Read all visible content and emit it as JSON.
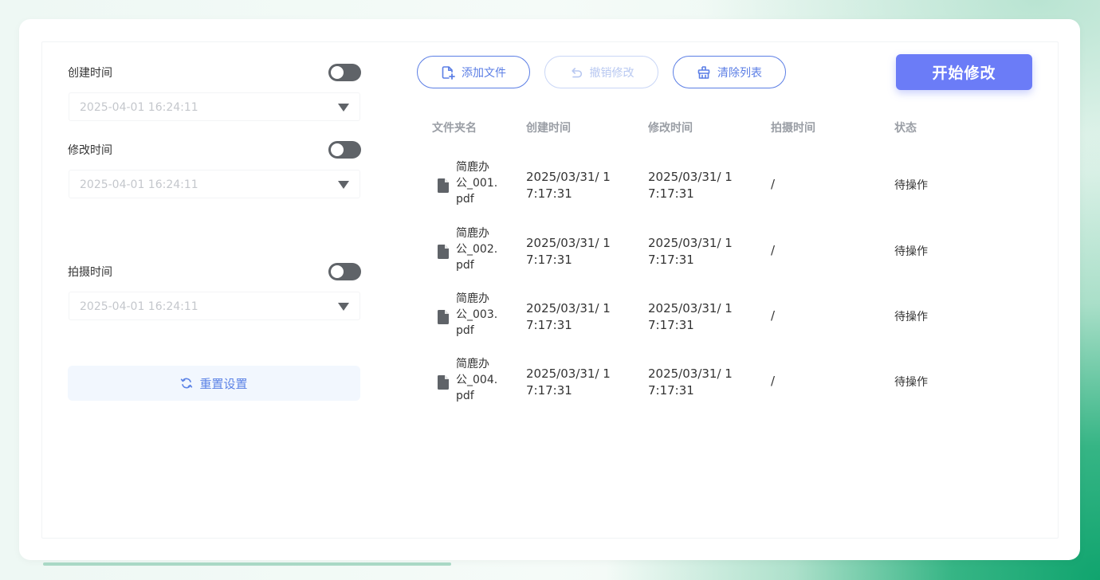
{
  "settings": {
    "created": {
      "label": "创建时间",
      "value": "2025-04-01 16:24:11",
      "enabled": false
    },
    "modified": {
      "label": "修改时间",
      "value": "2025-04-01 16:24:11",
      "enabled": false
    },
    "shot": {
      "label": "拍摄时间",
      "value": "2025-04-01 16:24:11",
      "enabled": false
    },
    "reset_label": "重置设置"
  },
  "toolbar": {
    "add_label": "添加文件",
    "undo_label": "撤销修改",
    "clear_label": "清除列表",
    "start_label": "开始修改"
  },
  "table": {
    "headers": {
      "name": "文件夹名",
      "created": "创建时间",
      "modified": "修改时间",
      "shot": "拍摄时间",
      "status": "状态"
    },
    "rows": [
      {
        "name": "简鹿办公_001.pdf",
        "created": "2025/03/31/ 17:17:31",
        "modified": "2025/03/31/ 17:17:31",
        "shot": "/",
        "status": "待操作"
      },
      {
        "name": "简鹿办公_002.pdf",
        "created": "2025/03/31/ 17:17:31",
        "modified": "2025/03/31/ 17:17:31",
        "shot": "/",
        "status": "待操作"
      },
      {
        "name": "简鹿办公_003.pdf",
        "created": "2025/03/31/ 17:17:31",
        "modified": "2025/03/31/ 17:17:31",
        "shot": "/",
        "status": "待操作"
      },
      {
        "name": "简鹿办公_004.pdf",
        "created": "2025/03/31/ 17:17:31",
        "modified": "2025/03/31/ 17:17:31",
        "shot": "/",
        "status": "待操作"
      }
    ]
  },
  "colors": {
    "accent": "#6b7cf7",
    "outline_button": "#5b7ee5",
    "toggle_off": "#5f6368",
    "background_green": "#10a46e"
  },
  "icons": {
    "add": "add-file-icon",
    "undo": "undo-icon",
    "clear": "clear-list-icon",
    "reset": "refresh-icon",
    "file": "file-icon",
    "dropdown": "caret-down-icon"
  }
}
